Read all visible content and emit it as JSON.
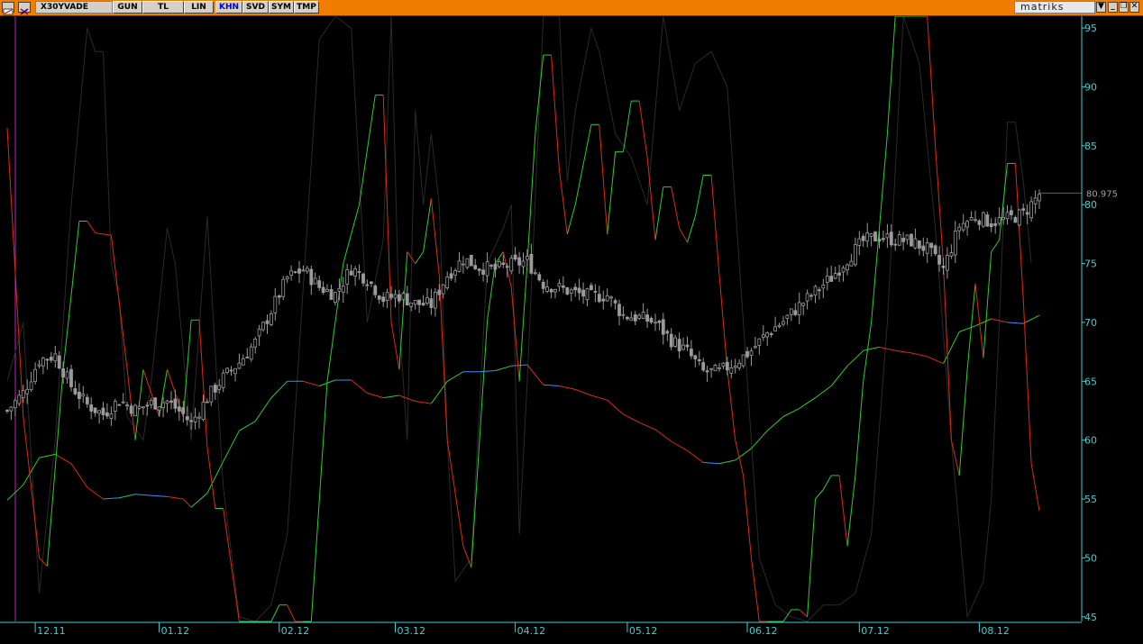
{
  "toolbar": {
    "symbol": "X30YVADE",
    "buttons": [
      "GUN",
      "TL",
      "LIN",
      "KHN",
      "SVD",
      "SYM",
      "TMP"
    ],
    "active_button": "KHN",
    "brand": "matriks",
    "dropdown_glyph": "▼",
    "minimize_glyph": "_",
    "restore_glyph": "❐",
    "close_glyph": "✕"
  },
  "colors": {
    "toolbar": "#f07c00",
    "background": "#000000",
    "axis": "#40d0d0",
    "candle": "#9a9a9a",
    "indicator_up": "#2ecc2e",
    "indicator_down": "#e02a10",
    "average_line_flat": "#3a8cff",
    "secondary_line": "#2a2a2a",
    "left_marker": "#c020c0"
  },
  "chart_data": {
    "type": "line",
    "price_label": "80.975",
    "price_value": 80.975,
    "y_ticks": [
      95,
      90,
      85,
      80,
      75,
      70,
      65,
      60,
      55,
      50,
      45
    ],
    "ylim": [
      44.6,
      96.0
    ],
    "x_ticks": [
      "12.11",
      "01.12",
      "02.12",
      "03.12",
      "04.12",
      "05.12",
      "06.12",
      "07.12",
      "08.12"
    ],
    "x_tick_bars": [
      7,
      38,
      68,
      97,
      127,
      155,
      185,
      213,
      243
    ],
    "bar_count": 259,
    "price_series": [
      [
        0,
        62.5
      ],
      [
        4,
        64.0
      ],
      [
        8,
        66.8
      ],
      [
        12,
        67.2
      ],
      [
        16,
        64.6
      ],
      [
        20,
        63.0
      ],
      [
        24,
        62.2
      ],
      [
        28,
        63.4
      ],
      [
        32,
        62.6
      ],
      [
        36,
        63.1
      ],
      [
        40,
        63.3
      ],
      [
        44,
        62.2
      ],
      [
        46,
        61.4
      ],
      [
        50,
        63.6
      ],
      [
        54,
        65.3
      ],
      [
        58,
        66.6
      ],
      [
        62,
        68.3
      ],
      [
        66,
        71.0
      ],
      [
        70,
        73.8
      ],
      [
        74,
        74.5
      ],
      [
        78,
        73.0
      ],
      [
        82,
        72.4
      ],
      [
        86,
        74.6
      ],
      [
        90,
        73.7
      ],
      [
        94,
        72.0
      ],
      [
        98,
        72.3
      ],
      [
        102,
        71.6
      ],
      [
        106,
        71.5
      ],
      [
        110,
        74.0
      ],
      [
        114,
        75.4
      ],
      [
        118,
        74.7
      ],
      [
        122,
        74.5
      ],
      [
        126,
        74.9
      ],
      [
        130,
        75.2
      ],
      [
        134,
        73.3
      ],
      [
        138,
        72.9
      ],
      [
        142,
        72.5
      ],
      [
        146,
        72.2
      ],
      [
        150,
        72.3
      ],
      [
        154,
        70.6
      ],
      [
        158,
        70.4
      ],
      [
        162,
        70.0
      ],
      [
        166,
        68.5
      ],
      [
        170,
        67.5
      ],
      [
        174,
        65.8
      ],
      [
        178,
        65.8
      ],
      [
        182,
        66.6
      ],
      [
        186,
        67.6
      ],
      [
        190,
        69.1
      ],
      [
        194,
        70.1
      ],
      [
        198,
        71.4
      ],
      [
        202,
        72.6
      ],
      [
        206,
        73.8
      ],
      [
        210,
        75.4
      ],
      [
        214,
        76.9
      ],
      [
        218,
        77.3
      ],
      [
        222,
        77.0
      ],
      [
        226,
        76.9
      ],
      [
        230,
        76.2
      ],
      [
        234,
        74.5
      ],
      [
        238,
        78.2
      ],
      [
        242,
        79.0
      ],
      [
        246,
        78.5
      ],
      [
        250,
        78.8
      ],
      [
        254,
        79.2
      ],
      [
        258,
        80.9
      ]
    ],
    "average_series": [
      [
        0,
        54.9
      ],
      [
        4,
        56.2
      ],
      [
        8,
        58.5
      ],
      [
        12,
        58.8
      ],
      [
        16,
        58.0
      ],
      [
        20,
        56.0
      ],
      [
        24,
        55.0
      ],
      [
        28,
        55.1
      ],
      [
        32,
        55.4
      ],
      [
        36,
        55.3
      ],
      [
        40,
        55.2
      ],
      [
        44,
        55.0
      ],
      [
        46,
        54.3
      ],
      [
        50,
        55.5
      ],
      [
        54,
        58.2
      ],
      [
        58,
        60.8
      ],
      [
        62,
        61.6
      ],
      [
        66,
        63.6
      ],
      [
        70,
        65.0
      ],
      [
        74,
        65.0
      ],
      [
        78,
        64.6
      ],
      [
        82,
        65.1
      ],
      [
        86,
        65.1
      ],
      [
        90,
        64.0
      ],
      [
        94,
        63.6
      ],
      [
        98,
        63.8
      ],
      [
        102,
        63.3
      ],
      [
        106,
        63.1
      ],
      [
        110,
        65.0
      ],
      [
        114,
        65.8
      ],
      [
        118,
        65.8
      ],
      [
        122,
        65.9
      ],
      [
        126,
        66.3
      ],
      [
        130,
        66.4
      ],
      [
        134,
        64.7
      ],
      [
        138,
        64.6
      ],
      [
        142,
        64.3
      ],
      [
        146,
        63.8
      ],
      [
        150,
        63.4
      ],
      [
        154,
        62.2
      ],
      [
        158,
        61.5
      ],
      [
        162,
        60.9
      ],
      [
        166,
        59.9
      ],
      [
        170,
        59.1
      ],
      [
        174,
        58.1
      ],
      [
        178,
        58.0
      ],
      [
        182,
        58.3
      ],
      [
        186,
        59.3
      ],
      [
        190,
        60.8
      ],
      [
        194,
        62.0
      ],
      [
        198,
        62.7
      ],
      [
        202,
        63.6
      ],
      [
        206,
        64.6
      ],
      [
        210,
        66.3
      ],
      [
        214,
        67.6
      ],
      [
        218,
        67.9
      ],
      [
        222,
        67.6
      ],
      [
        226,
        67.4
      ],
      [
        230,
        67.1
      ],
      [
        234,
        66.5
      ],
      [
        238,
        69.2
      ],
      [
        242,
        69.7
      ],
      [
        246,
        70.3
      ],
      [
        250,
        70.0
      ],
      [
        254,
        69.9
      ],
      [
        258,
        70.6
      ]
    ],
    "oscillator_series": [
      [
        0,
        86.5
      ],
      [
        4,
        62.0
      ],
      [
        8,
        50.0
      ],
      [
        10,
        49.3
      ],
      [
        14,
        66.0
      ],
      [
        18,
        78.6
      ],
      [
        20,
        78.6
      ],
      [
        22,
        77.6
      ],
      [
        26,
        77.4
      ],
      [
        30,
        66.0
      ],
      [
        32,
        60.0
      ],
      [
        34,
        66.0
      ],
      [
        38,
        62.0
      ],
      [
        40,
        66.0
      ],
      [
        44,
        62.0
      ],
      [
        46,
        70.2
      ],
      [
        48,
        70.2
      ],
      [
        50,
        59.4
      ],
      [
        52,
        54.2
      ],
      [
        54,
        54.2
      ],
      [
        58,
        43.5
      ],
      [
        66,
        43.5
      ],
      [
        68,
        46.0
      ],
      [
        70,
        46.0
      ],
      [
        72,
        43.5
      ],
      [
        74,
        38.0
      ],
      [
        76,
        44.0
      ],
      [
        80,
        65.0
      ],
      [
        84,
        75.0
      ],
      [
        88,
        80.0
      ],
      [
        92,
        89.3
      ],
      [
        94,
        89.3
      ],
      [
        96,
        70.0
      ],
      [
        98,
        66.0
      ],
      [
        100,
        76.0
      ],
      [
        102,
        75.0
      ],
      [
        104,
        76.0
      ],
      [
        106,
        80.5
      ],
      [
        108,
        74.0
      ],
      [
        110,
        60.0
      ],
      [
        114,
        51.0
      ],
      [
        116,
        49.2
      ],
      [
        120,
        70.2
      ],
      [
        122,
        75.0
      ],
      [
        124,
        76.0
      ],
      [
        126,
        73.0
      ],
      [
        128,
        65.0
      ],
      [
        130,
        75.0
      ],
      [
        132,
        86.0
      ],
      [
        134,
        92.7
      ],
      [
        136,
        92.7
      ],
      [
        138,
        83.0
      ],
      [
        140,
        77.5
      ],
      [
        142,
        80.0
      ],
      [
        146,
        86.8
      ],
      [
        148,
        86.8
      ],
      [
        150,
        77.5
      ],
      [
        152,
        84.5
      ],
      [
        154,
        84.5
      ],
      [
        156,
        88.8
      ],
      [
        158,
        88.8
      ],
      [
        160,
        84.0
      ],
      [
        162,
        77.0
      ],
      [
        164,
        81.5
      ],
      [
        166,
        81.5
      ],
      [
        168,
        78.0
      ],
      [
        170,
        76.8
      ],
      [
        172,
        79.0
      ],
      [
        174,
        82.5
      ],
      [
        176,
        82.5
      ],
      [
        178,
        74.0
      ],
      [
        180,
        66.0
      ],
      [
        182,
        60.0
      ],
      [
        184,
        57.0
      ],
      [
        186,
        50.0
      ],
      [
        188,
        44.0
      ],
      [
        190,
        40.0
      ],
      [
        194,
        40.0
      ],
      [
        196,
        45.6
      ],
      [
        198,
        45.6
      ],
      [
        200,
        45.0
      ],
      [
        202,
        55.0
      ],
      [
        204,
        55.8
      ],
      [
        206,
        57.0
      ],
      [
        208,
        57.0
      ],
      [
        210,
        51.0
      ],
      [
        212,
        57.0
      ],
      [
        214,
        65.0
      ],
      [
        216,
        70.0
      ],
      [
        218,
        78.0
      ],
      [
        220,
        86.0
      ],
      [
        222,
        96.0
      ],
      [
        230,
        96.0
      ],
      [
        232,
        85.0
      ],
      [
        234,
        75.0
      ],
      [
        236,
        60.0
      ],
      [
        238,
        57.0
      ],
      [
        240,
        66.0
      ],
      [
        242,
        73.3
      ],
      [
        244,
        67.0
      ],
      [
        246,
        76.0
      ],
      [
        248,
        77.0
      ],
      [
        250,
        83.5
      ],
      [
        252,
        83.5
      ],
      [
        254,
        72.0
      ],
      [
        256,
        58.0
      ],
      [
        258,
        54.0
      ]
    ],
    "secondary_series": [
      [
        0,
        65.0
      ],
      [
        4,
        70.0
      ],
      [
        8,
        47.0
      ],
      [
        12,
        60.0
      ],
      [
        16,
        80.0
      ],
      [
        20,
        95.0
      ],
      [
        22,
        93.0
      ],
      [
        24,
        93.0
      ],
      [
        26,
        75.0
      ],
      [
        28,
        72.0
      ],
      [
        30,
        62.0
      ],
      [
        34,
        60.0
      ],
      [
        36,
        65.0
      ],
      [
        40,
        78.0
      ],
      [
        42,
        75.0
      ],
      [
        46,
        60.0
      ],
      [
        50,
        79.0
      ],
      [
        54,
        56.0
      ],
      [
        58,
        45.0
      ],
      [
        62,
        44.0
      ],
      [
        66,
        46.0
      ],
      [
        70,
        52.0
      ],
      [
        74,
        73.0
      ],
      [
        78,
        94.0
      ],
      [
        82,
        100.0
      ],
      [
        86,
        95.0
      ],
      [
        90,
        70.0
      ],
      [
        94,
        77.0
      ],
      [
        96,
        100.0
      ],
      [
        98,
        70.0
      ],
      [
        100,
        60.0
      ],
      [
        102,
        88.0
      ],
      [
        104,
        80.0
      ],
      [
        106,
        86.0
      ],
      [
        108,
        80.0
      ],
      [
        110,
        60.0
      ],
      [
        112,
        48.0
      ],
      [
        116,
        50.0
      ],
      [
        120,
        75.0
      ],
      [
        124,
        78.0
      ],
      [
        126,
        80.0
      ],
      [
        128,
        52.0
      ],
      [
        130,
        65.0
      ],
      [
        134,
        98.0
      ],
      [
        138,
        100.0
      ],
      [
        140,
        82.0
      ],
      [
        142,
        88.0
      ],
      [
        146,
        95.0
      ],
      [
        148,
        93.0
      ],
      [
        152,
        86.0
      ],
      [
        156,
        84.0
      ],
      [
        160,
        80.0
      ],
      [
        164,
        96.0
      ],
      [
        168,
        88.0
      ],
      [
        172,
        92.0
      ],
      [
        176,
        93.0
      ],
      [
        180,
        90.0
      ],
      [
        184,
        70.0
      ],
      [
        188,
        50.0
      ],
      [
        192,
        46.0
      ],
      [
        196,
        45.0
      ],
      [
        200,
        44.0
      ],
      [
        204,
        46.0
      ],
      [
        208,
        46.0
      ],
      [
        212,
        47.0
      ],
      [
        216,
        52.0
      ],
      [
        220,
        70.0
      ],
      [
        224,
        96.0
      ],
      [
        228,
        92.0
      ],
      [
        232,
        78.0
      ],
      [
        236,
        60.0
      ],
      [
        240,
        45.0
      ],
      [
        244,
        48.0
      ],
      [
        246,
        55.0
      ],
      [
        248,
        70.0
      ],
      [
        250,
        87.0
      ],
      [
        252,
        87.0
      ],
      [
        254,
        82.0
      ],
      [
        256,
        75.0
      ]
    ]
  }
}
